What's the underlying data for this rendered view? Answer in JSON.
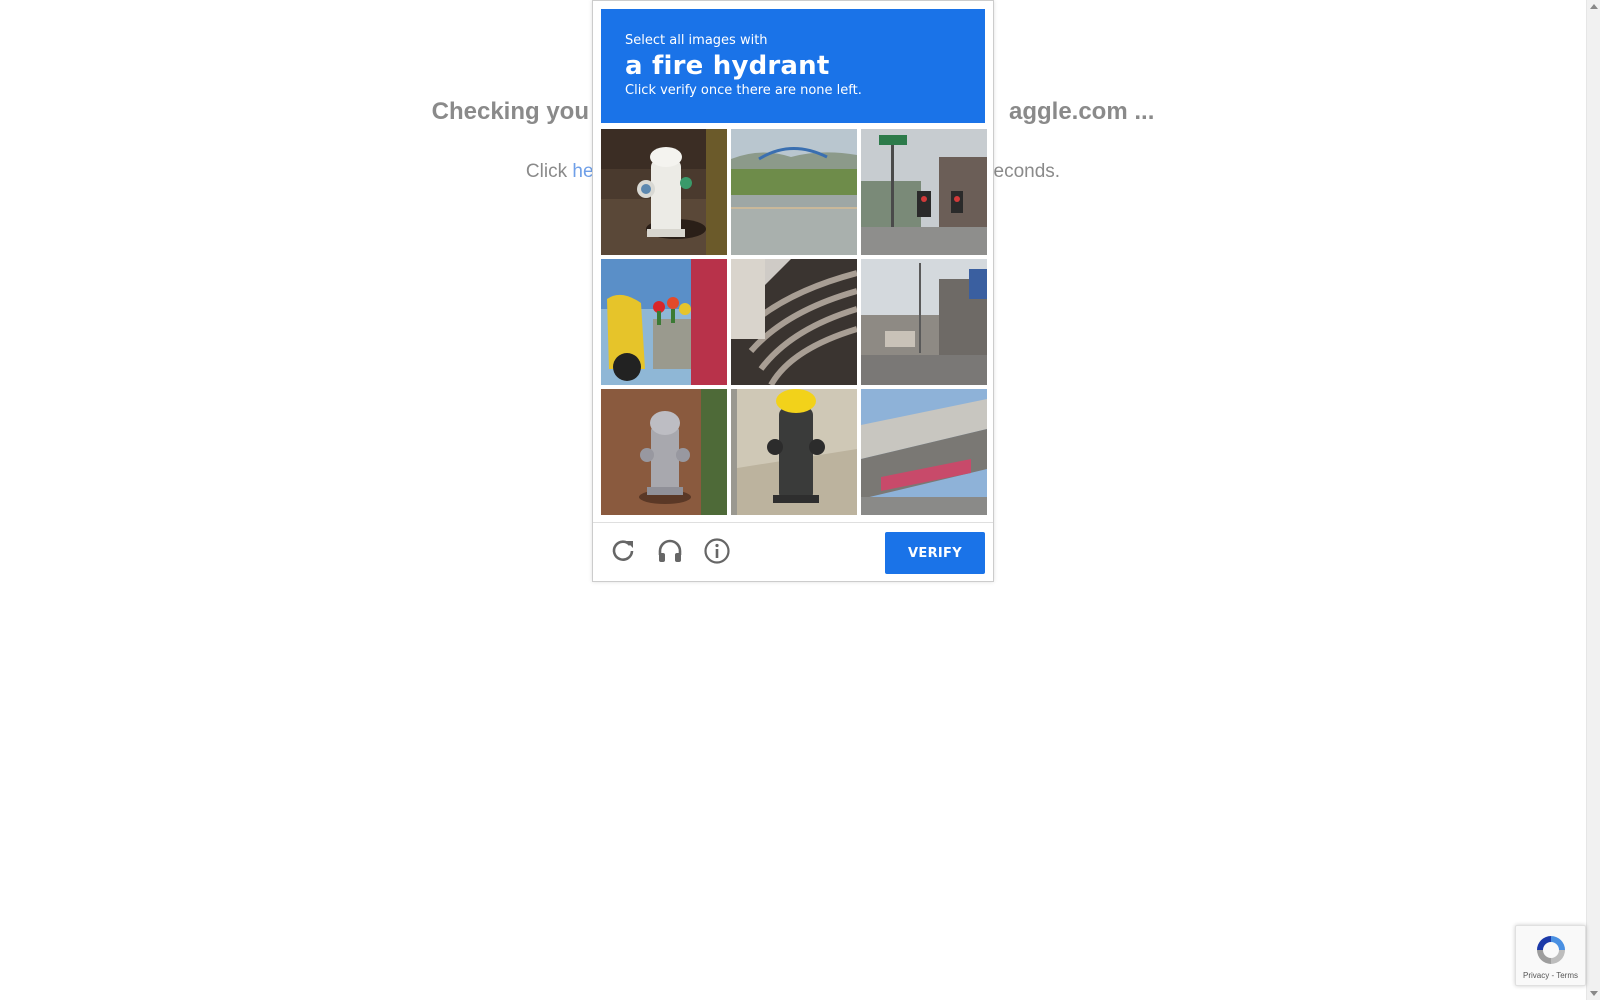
{
  "background_page": {
    "title_visible_left": "Checking you",
    "title_visible_right": "aggle.com ...",
    "subtitle_prefix": "Click ",
    "subtitle_link": "he",
    "subtitle_suffix": "econds."
  },
  "captcha": {
    "header_small": "Select all images with",
    "header_target": "a fire hydrant",
    "header_hint": "Click verify once there are none left.",
    "verify_label": "VERIFY",
    "accent_color": "#1a73e8",
    "tiles": [
      {
        "content": "white fire hydrant on mulch"
      },
      {
        "content": "road with bridge and field"
      },
      {
        "content": "street intersection with traffic lights"
      },
      {
        "content": "scooter with tulips"
      },
      {
        "content": "building balconies"
      },
      {
        "content": "street scene with buildings"
      },
      {
        "content": "gray fire hydrant on mulch"
      },
      {
        "content": "fire hydrant with yellow cap on sidewalk"
      },
      {
        "content": "highway overpass"
      }
    ],
    "footer_icons": [
      "reload-icon",
      "headphones-icon",
      "info-icon"
    ]
  },
  "recaptcha_badge": {
    "privacy": "Privacy",
    "separator": " - ",
    "terms": "Terms"
  }
}
